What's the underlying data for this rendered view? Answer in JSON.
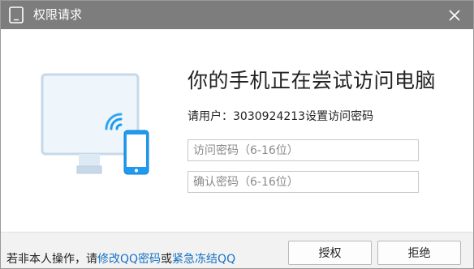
{
  "window": {
    "title": "权限请求"
  },
  "content": {
    "headline": "你的手机正在尝试访问电脑",
    "user_prefix": "请用户：",
    "user_id": "3030924213",
    "user_suffix": "设置访问密码",
    "password_placeholder": "访问密码（6-16位）",
    "confirm_placeholder": "确认密码（6-16位）",
    "password_value": "",
    "confirm_value": ""
  },
  "footer": {
    "notice_prefix": "若非本人操作，请",
    "change_password_link": "修改QQ密码",
    "notice_or": "或",
    "freeze_link": "紧急冻结QQ",
    "authorize_label": "授权",
    "reject_label": "拒绝"
  },
  "colors": {
    "titlebar": "#7d7d7d",
    "link": "#1572c5",
    "phone_blue": "#1e9bf0",
    "monitor_fill": "#eef5fb",
    "monitor_border": "#c7d9e8"
  },
  "icons": {
    "title": "tablet-icon",
    "close": "close-icon",
    "illustration_monitor": "monitor-icon",
    "illustration_phone": "phone-icon",
    "illustration_wifi": "wifi-signal-icon"
  }
}
